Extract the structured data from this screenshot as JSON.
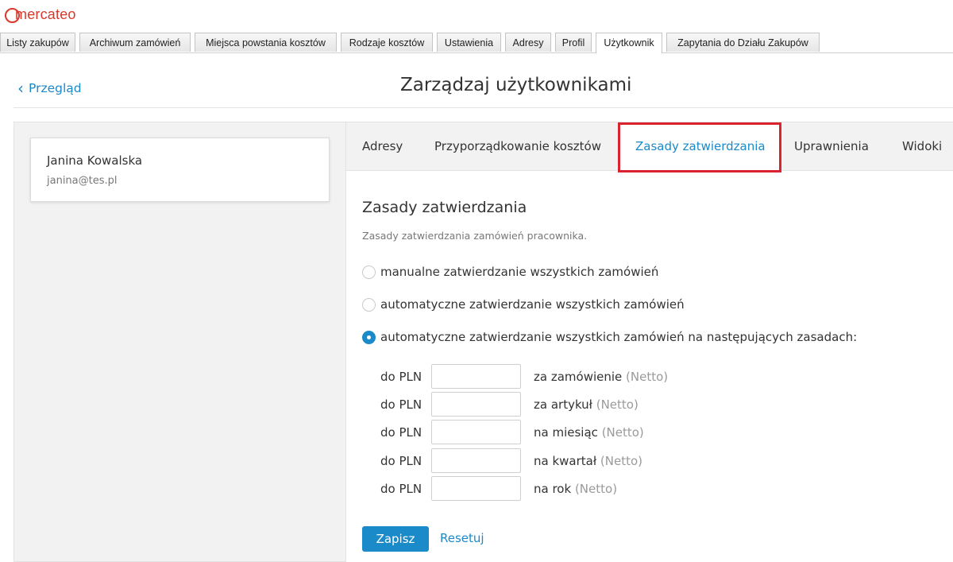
{
  "brand": {
    "logo_text": "mercateo",
    "color": "#d9382a"
  },
  "top_nav": [
    {
      "label": "Listy zakupów",
      "active": false
    },
    {
      "label": "Archiwum zamówień",
      "active": false
    },
    {
      "label": "Miejsca powstania kosztów",
      "active": false
    },
    {
      "label": "Rodzaje kosztów",
      "active": false
    },
    {
      "label": "Ustawienia",
      "active": false
    },
    {
      "label": "Adresy",
      "active": false
    },
    {
      "label": "Profil",
      "active": false
    },
    {
      "label": "Użytkownik",
      "active": true
    },
    {
      "label": "Zapytania do Działu Zakupów",
      "active": false
    }
  ],
  "header": {
    "back_label": "Przegląd",
    "back_icon": "chevron-left-icon",
    "title": "Zarządzaj użytkownikami"
  },
  "user": {
    "name": "Janina Kowalska",
    "email": "janina@tes.pl"
  },
  "sub_tabs": [
    {
      "label": "Adresy",
      "active": false
    },
    {
      "label": "Przyporządkowanie kosztów",
      "active": false
    },
    {
      "label": "Zasady zatwierdzania",
      "active": true
    },
    {
      "label": "Uprawnienia",
      "active": false
    },
    {
      "label": "Widoki",
      "active": false
    }
  ],
  "section": {
    "title": "Zasady zatwierdzania",
    "description": "Zasady zatwierdzania zamówień pracownika."
  },
  "approval_options": [
    {
      "label": "manualne zatwierdzanie wszystkich zamówień",
      "checked": false
    },
    {
      "label": "automatyczne zatwierdzanie wszystkich zamówień",
      "checked": false
    },
    {
      "label": "automatyczne zatwierdzanie wszystkich zamówień na następujących zasadach:",
      "checked": true
    }
  ],
  "limits": [
    {
      "currency_label": "do PLN",
      "value": "",
      "period": "za zamówienie",
      "net": "(Netto)"
    },
    {
      "currency_label": "do PLN",
      "value": "",
      "period": "za artykuł",
      "net": "(Netto)"
    },
    {
      "currency_label": "do PLN",
      "value": "",
      "period": "na miesiąc",
      "net": "(Netto)"
    },
    {
      "currency_label": "do PLN",
      "value": "",
      "period": "na kwartał",
      "net": "(Netto)"
    },
    {
      "currency_label": "do PLN",
      "value": "",
      "period": "na rok",
      "net": "(Netto)"
    }
  ],
  "actions": {
    "save_label": "Zapisz",
    "reset_label": "Resetuj"
  },
  "colors": {
    "accent": "#1a8ac9",
    "highlight": "#d9232e",
    "panel_bg": "#f2f2f2"
  }
}
